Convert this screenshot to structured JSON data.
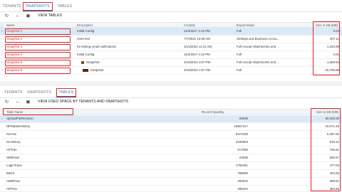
{
  "snapshots_panel": {
    "tabs": [
      "TENANTS",
      "SNAPSHOTS",
      "TABLES"
    ],
    "active_tab": "SNAPSHOTS",
    "toolbar": {
      "action_label": "VIEW TABLES"
    },
    "columns": [
      "Name",
      "Description",
      "Created",
      "Export Mode",
      "Size in DB (MB)"
    ],
    "rows": [
      {
        "name": "Snapshot 1",
        "description": "Initial Config",
        "created": "11/3/2017 4:12 PM",
        "mode": "Full",
        "size": "0.04"
      },
      {
        "name": "Snapshot 2",
        "description": "reset test",
        "created": "7/7/2021 10:38 AM",
        "mode": "Settings and Business Accou...",
        "size": "207.11"
      },
      {
        "name": "Snapshot 3",
        "description": "for testing email notifications",
        "created": "4/13/2022 11:31 AM",
        "mode": "Full except Attachments and ...",
        "size": "1,220.99"
      },
      {
        "name": "Snapshot 4",
        "description": "Initial Config",
        "created": "11/3/2017 4:12 PM",
        "mode": "Full",
        "size": "0.01"
      },
      {
        "name": "Snapshot 5",
        "description": "Snapshot",
        "created": "4/19/2022 4:57 PM",
        "mode": "Full except Attachments and ...",
        "size": "1,829.54"
      },
      {
        "name": "Snapshot 6",
        "description": "Snapshot",
        "created": "4/19/2022 1:57 PM",
        "mode": "Full",
        "size": "20,795.08"
      }
    ]
  },
  "tables_panel": {
    "tabs": [
      "TENANTS",
      "SNAPSHOTS",
      "TABLES"
    ],
    "active_tab": "TABLES",
    "toolbar": {
      "action_label": "VIEW USED SPACE BY TENANTS AND SNAPSHOTS"
    },
    "columns": [
      "Table Name",
      "Record Quantity",
      "Size in DB (MB)"
    ],
    "rows": [
      {
        "name": "UploadFileRevision",
        "records": "69538",
        "size": "82,029.28"
      },
      {
        "name": "NPMasterHistory",
        "records": "16657217",
        "size": "10,071.45"
      },
      {
        "name": "GLTran",
        "records": "6372430",
        "size": "5,297.92"
      },
      {
        "name": "GLHistory",
        "records": "3180853",
        "size": "916.12"
      },
      {
        "name": "APTran",
        "records": "617090",
        "size": "735.51"
      },
      {
        "name": "SMEmail",
        "records": "23838",
        "size": "556.67"
      },
      {
        "name": "LoginTrace",
        "records": "1750461",
        "size": "477.03"
      },
      {
        "name": "Batch",
        "records": "768090",
        "size": "403.65"
      },
      {
        "name": "AMMTran",
        "records": "282910",
        "size": "398.61"
      },
      {
        "name": "ARTran",
        "records": "286424",
        "size": "384.56"
      }
    ]
  },
  "icons": [
    "refresh-icon",
    "fit-columns-icon",
    "export-icon",
    "chevron-right-icon"
  ],
  "colors": {
    "accent": "#1d78c1",
    "highlight_box": "#e0242a",
    "selected_row": "#dbe9f6"
  }
}
